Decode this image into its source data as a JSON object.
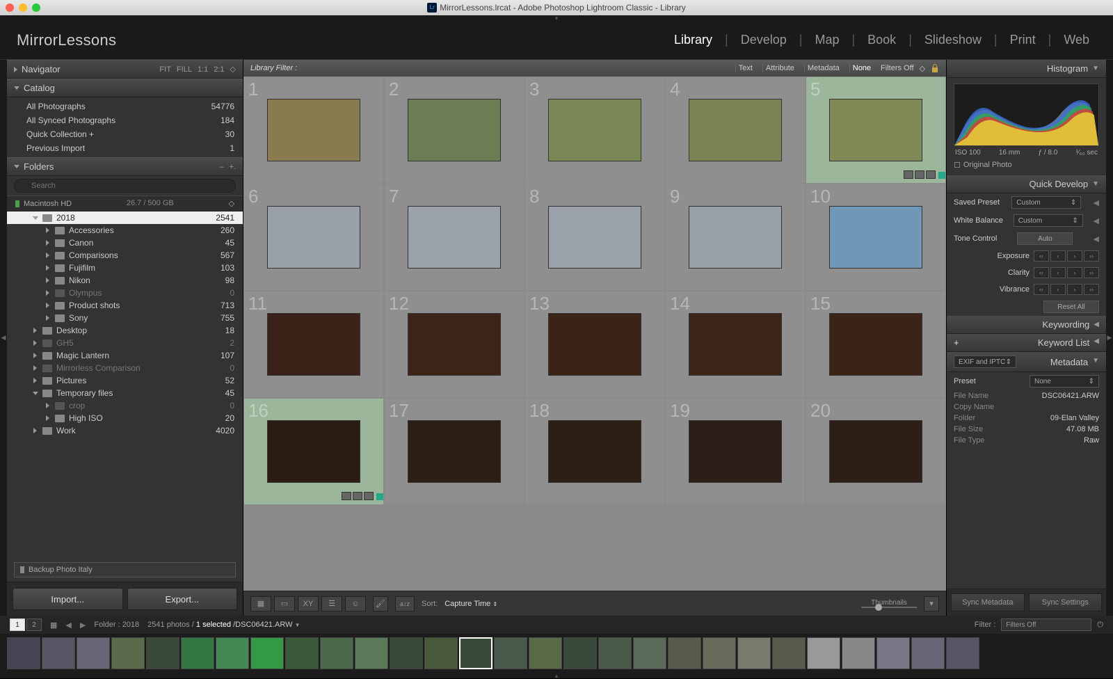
{
  "window": {
    "title": "MirrorLessons.lrcat - Adobe Photoshop Lightroom Classic - Library"
  },
  "brand": "MirrorLessons",
  "modules": {
    "items": [
      "Library",
      "Develop",
      "Map",
      "Book",
      "Slideshow",
      "Print",
      "Web"
    ],
    "active": "Library"
  },
  "navigator": {
    "title": "Navigator",
    "modes": [
      "FIT",
      "FILL",
      "1:1",
      "2:1"
    ]
  },
  "catalog": {
    "title": "Catalog",
    "items": [
      {
        "label": "All Photographs",
        "count": "54776"
      },
      {
        "label": "All Synced Photographs",
        "count": "184"
      },
      {
        "label": "Quick Collection  +",
        "count": "30"
      },
      {
        "label": "Previous Import",
        "count": "1"
      }
    ]
  },
  "folders": {
    "title": "Folders",
    "search_placeholder": "Search",
    "volume": {
      "name": "Macintosh HD",
      "usage": "26.7 / 500 GB"
    },
    "tree": [
      {
        "d": 1,
        "exp": "d",
        "label": "2018",
        "count": "2541",
        "sel": true
      },
      {
        "d": 2,
        "exp": "r",
        "label": "Accessories",
        "count": "260"
      },
      {
        "d": 2,
        "exp": "r",
        "label": "Canon",
        "count": "45"
      },
      {
        "d": 2,
        "exp": "r",
        "label": "Comparisons",
        "count": "567"
      },
      {
        "d": 2,
        "exp": "r",
        "label": "Fujifilm",
        "count": "103"
      },
      {
        "d": 2,
        "exp": "r",
        "label": "Nikon",
        "count": "98"
      },
      {
        "d": 2,
        "exp": "r",
        "label": "Olympus",
        "count": "0",
        "dim": true
      },
      {
        "d": 2,
        "exp": "r",
        "label": "Product shots",
        "count": "713"
      },
      {
        "d": 2,
        "exp": "r",
        "label": "Sony",
        "count": "755"
      },
      {
        "d": 1,
        "exp": "r",
        "label": "Desktop",
        "count": "18"
      },
      {
        "d": 1,
        "exp": "r",
        "label": "GH5",
        "count": "2",
        "dim": true
      },
      {
        "d": 1,
        "exp": "r",
        "label": "Magic Lantern",
        "count": "107"
      },
      {
        "d": 1,
        "exp": "r",
        "label": "Mirrorless Comparison",
        "count": "0",
        "dim": true
      },
      {
        "d": 1,
        "exp": "r",
        "label": "Pictures",
        "count": "52"
      },
      {
        "d": 1,
        "exp": "d",
        "label": "Temporary files",
        "count": "45"
      },
      {
        "d": 2,
        "exp": "r",
        "label": "crop",
        "count": "0",
        "dim": true
      },
      {
        "d": 2,
        "exp": "r",
        "label": "High ISO",
        "count": "20"
      },
      {
        "d": 1,
        "exp": "r",
        "label": "Work",
        "count": "4020"
      }
    ],
    "backup": "Backup Photo Italy"
  },
  "actions": {
    "import": "Import...",
    "export": "Export..."
  },
  "filter_bar": {
    "label": "Library Filter :",
    "items": [
      "Text",
      "Attribute",
      "Metadata",
      "None"
    ],
    "active": "None",
    "filters_off": "Filters Off"
  },
  "grid": {
    "cells": [
      {
        "n": "1",
        "c": "#8a7a4f"
      },
      {
        "n": "2",
        "c": "#6b7d52"
      },
      {
        "n": "3",
        "c": "#7a8855"
      },
      {
        "n": "4",
        "c": "#7b8454"
      },
      {
        "n": "5",
        "c": "#7f8a56",
        "sel": true
      },
      {
        "n": "6",
        "c": "#9aa0a8"
      },
      {
        "n": "7",
        "c": "#9ba2ac"
      },
      {
        "n": "8",
        "c": "#9aa1aa"
      },
      {
        "n": "9",
        "c": "#98a0a9"
      },
      {
        "n": "10",
        "c": "#6f98b8"
      },
      {
        "n": "11",
        "c": "#3a2218"
      },
      {
        "n": "12",
        "c": "#3c2418"
      },
      {
        "n": "13",
        "c": "#3b2318"
      },
      {
        "n": "14",
        "c": "#3c2519"
      },
      {
        "n": "15",
        "c": "#3b2318"
      },
      {
        "n": "16",
        "c": "#2b1d14",
        "sel": true
      },
      {
        "n": "17",
        "c": "#2c1e15"
      },
      {
        "n": "18",
        "c": "#2d1f16"
      },
      {
        "n": "19",
        "c": "#2c1e16"
      },
      {
        "n": "20",
        "c": "#2d1f15"
      }
    ]
  },
  "toolbar": {
    "sort_label": "Sort:",
    "sort_value": "Capture Time",
    "thumb_label": "Thumbnails"
  },
  "info_bar": {
    "views": [
      "1",
      "2"
    ],
    "folder": "Folder : 2018",
    "status": "2541 photos /",
    "selected": "1 selected",
    "file": "/DSC06421.ARW",
    "filter_label": "Filter :",
    "filter_value": "Filters Off"
  },
  "histogram": {
    "title": "Histogram",
    "iso": "ISO 100",
    "focal": "16 mm",
    "aperture": "ƒ / 8.0",
    "shutter": "¹⁄₆₀ sec",
    "original": "Original Photo"
  },
  "quick_develop": {
    "title": "Quick Develop",
    "saved_preset": {
      "label": "Saved Preset",
      "value": "Custom"
    },
    "white_balance": {
      "label": "White Balance",
      "value": "Custom"
    },
    "tone_control": {
      "label": "Tone Control",
      "auto": "Auto"
    },
    "exposure": "Exposure",
    "clarity": "Clarity",
    "vibrance": "Vibrance",
    "reset": "Reset All"
  },
  "keywording": {
    "title": "Keywording"
  },
  "keyword_list": {
    "title": "Keyword List",
    "plus": "+"
  },
  "metadata": {
    "title": "Metadata",
    "set": "EXIF and IPTC",
    "preset_label": "Preset",
    "preset_value": "None",
    "rows": [
      {
        "k": "File Name",
        "v": "DSC06421.ARW"
      },
      {
        "k": "Copy Name",
        "v": ""
      },
      {
        "k": "Folder",
        "v": "09-Elan Valley"
      },
      {
        "k": "File Size",
        "v": "47.08 MB"
      },
      {
        "k": "File Type",
        "v": "Raw"
      }
    ]
  },
  "sync": {
    "meta": "Sync Metadata",
    "settings": "Sync Settings"
  }
}
